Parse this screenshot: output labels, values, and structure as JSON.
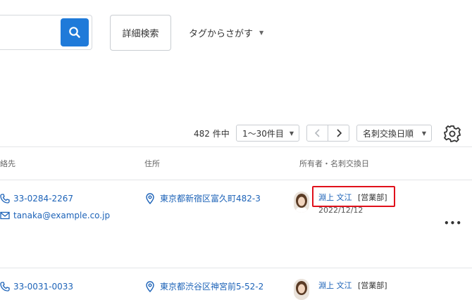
{
  "search": {
    "button_icon": "search-icon",
    "accent": "#1f7ad9"
  },
  "toolbar": {
    "advanced_search": "詳細検索",
    "tag_search": "タグからさがす"
  },
  "results": {
    "count": "482 件中",
    "range": "1〜30件目",
    "sort": "名刺交換日順"
  },
  "table": {
    "headers": {
      "contact": "絡先",
      "address": "住所",
      "owner": "所有者・名刺交換日"
    },
    "rows": [
      {
        "phone": "33-0284-2267",
        "email": "tanaka@example.co.jp",
        "address": "東京都新宿区富久町482-3",
        "owner_name": "淵上 文江",
        "owner_dept": "[営業部]",
        "date": "2022/12/12"
      },
      {
        "phone": "33-0031-0033",
        "address": "東京都渋谷区神宮前5-52-2",
        "owner_name": "淵上 文江",
        "owner_dept": "[営業部]"
      }
    ]
  },
  "more_label": "•••"
}
